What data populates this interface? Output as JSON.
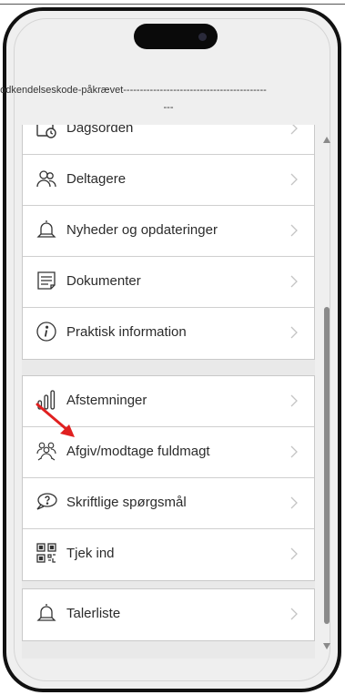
{
  "error_banner": {
    "line1": "godkendelseskode-påkrævet-------------------------------------------",
    "line2": "---"
  },
  "menu": {
    "group1": [
      {
        "label": "Dagsorden",
        "icon": "calendar-icon"
      },
      {
        "label": "Deltagere",
        "icon": "people-icon"
      },
      {
        "label": "Nyheder og opdateringer",
        "icon": "bell-icon"
      },
      {
        "label": "Dokumenter",
        "icon": "document-icon"
      },
      {
        "label": "Praktisk information",
        "icon": "info-icon"
      }
    ],
    "group2": [
      {
        "label": "Afstemninger",
        "icon": "bar-chart-icon"
      },
      {
        "label": "Afgiv/modtage fuldmagt",
        "icon": "proxy-people-icon"
      },
      {
        "label": "Skriftlige spørgsmål",
        "icon": "speech-bubble-icon"
      },
      {
        "label": "Tjek ind",
        "icon": "qr-code-icon"
      }
    ],
    "group3": [
      {
        "label": "Talerliste",
        "icon": "bell-icon"
      }
    ]
  },
  "colors": {
    "arrow": "#e02020",
    "background": "#e9e9e9",
    "card": "#ffffff",
    "frame": "#111111"
  }
}
